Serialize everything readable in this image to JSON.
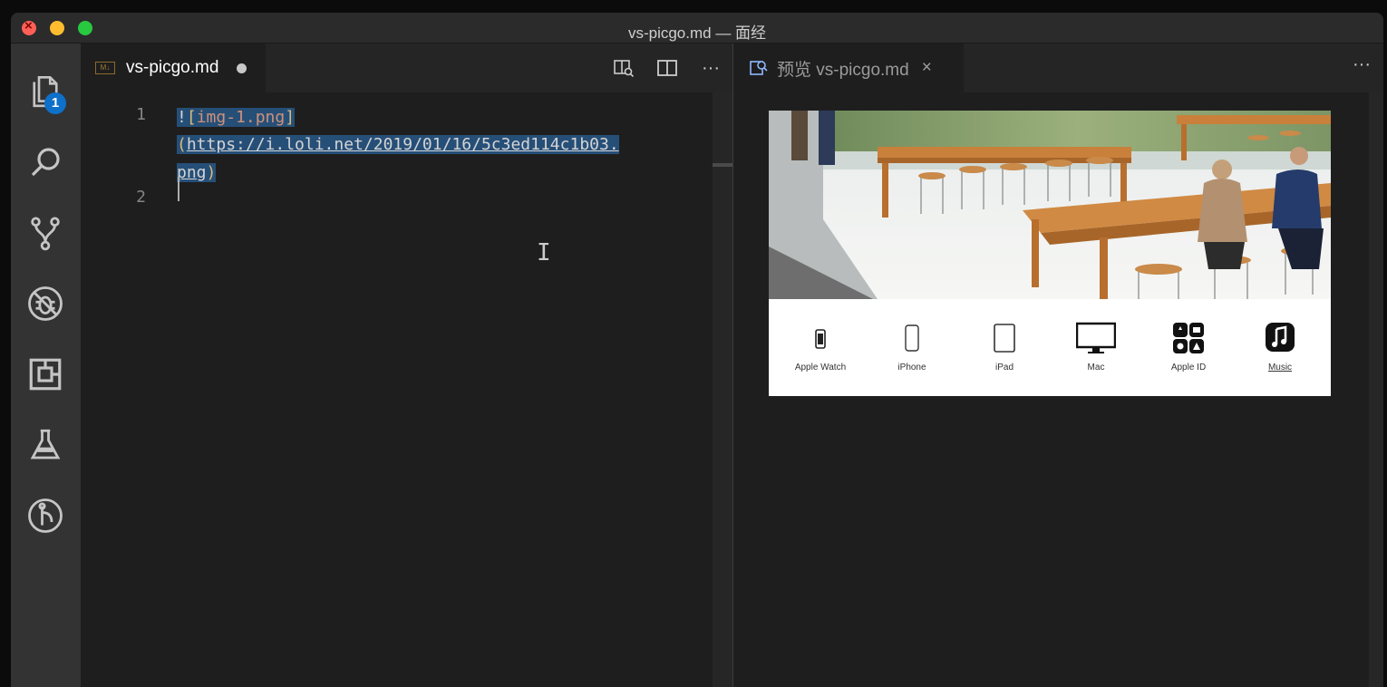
{
  "window": {
    "title": "vs-picgo.md — 面经"
  },
  "activity_bar": {
    "items": [
      {
        "name": "explorer",
        "icon": "files-icon",
        "badge": "1"
      },
      {
        "name": "search",
        "icon": "search-icon"
      },
      {
        "name": "source-control",
        "icon": "source-control-icon"
      },
      {
        "name": "debug",
        "icon": "debug-icon"
      },
      {
        "name": "extensions",
        "icon": "extensions-icon"
      },
      {
        "name": "test",
        "icon": "flask-icon"
      },
      {
        "name": "gitlens",
        "icon": "git-graph-icon"
      }
    ]
  },
  "editor": {
    "tab": {
      "label": "vs-picgo.md",
      "icon": "markdown-file-icon",
      "dirty": true
    },
    "actions": [
      "open-preview-icon",
      "split-editor-icon",
      "more-icon"
    ],
    "line_numbers": [
      "1",
      "2"
    ],
    "code": {
      "bang": "!",
      "open_bracket": "[",
      "alt_text": "img-1.png",
      "close_bracket": "]",
      "open_paren": "(",
      "url_part1": "https://i.loli.net/2019/01/16/5c3ed114c1b03.",
      "url_part2": "png",
      "close_paren": ")"
    }
  },
  "preview": {
    "tab": {
      "label": "预览 vs-picgo.md",
      "icon": "preview-icon",
      "close": "×"
    },
    "more": "···",
    "image": {
      "products": [
        {
          "label": "Apple Watch",
          "icon": "apple-watch-icon"
        },
        {
          "label": "iPhone",
          "icon": "iphone-icon"
        },
        {
          "label": "iPad",
          "icon": "ipad-icon"
        },
        {
          "label": "Mac",
          "icon": "mac-icon"
        },
        {
          "label": "Apple ID",
          "icon": "apple-id-icon"
        },
        {
          "label": "Music",
          "icon": "music-icon",
          "link": true
        }
      ]
    }
  },
  "colors": {
    "selection": "#264f78",
    "badge": "#0e70c9",
    "alt_text": "#ce9178",
    "brackets": "#d7ba7d"
  }
}
